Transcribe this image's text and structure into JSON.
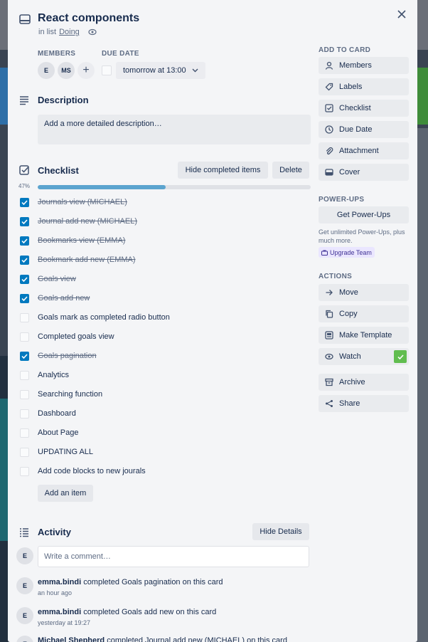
{
  "card": {
    "title": "React components",
    "in_list_prefix": "in list",
    "list_name": "Doing"
  },
  "members": {
    "label": "MEMBERS",
    "avatars": [
      "E",
      "MS"
    ],
    "add": "+"
  },
  "due": {
    "label": "DUE DATE",
    "value": "tomorrow at 13:00"
  },
  "description": {
    "title": "Description",
    "placeholder": "Add a more detailed description…"
  },
  "checklist": {
    "title": "Checklist",
    "hide_completed": "Hide completed items",
    "delete": "Delete",
    "progress_label": "47%",
    "progress": 0.47,
    "add_item": "Add an item",
    "items": [
      {
        "text": "Journals view (MICHAEL)",
        "done": true
      },
      {
        "text": "Journal add new (MICHAEL)",
        "done": true
      },
      {
        "text": "Bookmarks view (EMMA)",
        "done": true
      },
      {
        "text": "Bookmark add new (EMMA)",
        "done": true
      },
      {
        "text": "Goals view",
        "done": true
      },
      {
        "text": "Goals add new",
        "done": true
      },
      {
        "text": "Goals mark as completed radio button",
        "done": false
      },
      {
        "text": "Completed goals view",
        "done": false
      },
      {
        "text": "Goals pagination",
        "done": true
      },
      {
        "text": "Analytics",
        "done": false
      },
      {
        "text": "Searching function",
        "done": false
      },
      {
        "text": "Dashboard",
        "done": false
      },
      {
        "text": "About Page",
        "done": false
      },
      {
        "text": "UPDATING ALL",
        "done": false
      },
      {
        "text": "Add code blocks to new jourals",
        "done": false
      }
    ]
  },
  "activity": {
    "title": "Activity",
    "hide_details": "Hide Details",
    "avatar": "E",
    "comment_placeholder": "Write a comment…",
    "entries": [
      {
        "user": "emma.bindi",
        "action": "completed Goals pagination on this card",
        "time": "an hour ago"
      },
      {
        "user": "emma.bindi",
        "action": "completed Goals add new on this card",
        "time": "yesterday at 19:27"
      },
      {
        "user": "Michael Shepherd",
        "action": "completed Journal add new (MICHAEL) on this card",
        "time": ""
      }
    ]
  },
  "sidebar": {
    "add_to_card_label": "ADD TO CARD",
    "add_to_card": [
      {
        "label": "Members",
        "icon": "person-icon"
      },
      {
        "label": "Labels",
        "icon": "tag-icon"
      },
      {
        "label": "Checklist",
        "icon": "checklist-icon"
      },
      {
        "label": "Due Date",
        "icon": "clock-icon"
      },
      {
        "label": "Attachment",
        "icon": "paperclip-icon"
      },
      {
        "label": "Cover",
        "icon": "cover-icon"
      }
    ],
    "powerups_label": "POWER-UPS",
    "get_powerups": "Get Power-Ups",
    "powerups_note": "Get unlimited Power-Ups, plus much more.",
    "upgrade": "Upgrade Team",
    "actions_label": "ACTIONS",
    "actions": [
      {
        "label": "Move",
        "icon": "arrow-right-icon"
      },
      {
        "label": "Copy",
        "icon": "copy-icon"
      },
      {
        "label": "Make Template",
        "icon": "template-icon"
      },
      {
        "label": "Watch",
        "icon": "eye-icon"
      },
      {
        "label": "Archive",
        "icon": "archive-icon"
      },
      {
        "label": "Share",
        "icon": "share-icon"
      }
    ]
  },
  "colors": {
    "checked": "#0079bf",
    "progress": "#5ba4cf",
    "watch_active": "#61bd4f"
  }
}
